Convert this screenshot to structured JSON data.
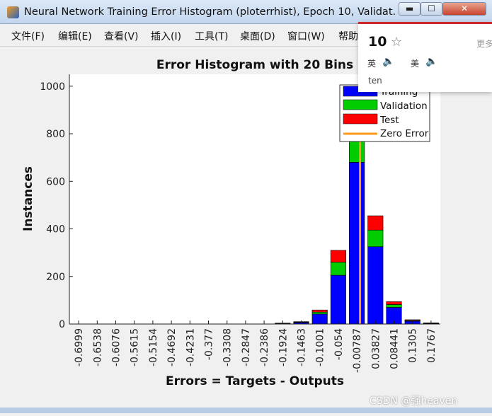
{
  "window": {
    "title": "Neural Network Training Error Histogram (ploterrhist), Epoch 10, Validat...",
    "controls": {
      "minimize": "▬",
      "maximize": "☐",
      "close": "✕"
    }
  },
  "menubar": {
    "items": [
      "文件(F)",
      "编辑(E)",
      "查看(V)",
      "插入(I)",
      "工具(T)",
      "桌面(D)",
      "窗口(W)",
      "帮助"
    ]
  },
  "chart_data": {
    "type": "bar",
    "title": "Error Histogram with 20 Bins",
    "xlabel": "Errors = Targets - Outputs",
    "ylabel": "Instances",
    "ylim": [
      0,
      1050
    ],
    "yticks": [
      "0",
      "200",
      "400",
      "600",
      "800",
      "1000"
    ],
    "categories": [
      "-0.6999",
      "-0.6538",
      "-0.6076",
      "-0.5615",
      "-0.5154",
      "-0.4692",
      "-0.4231",
      "-0.377",
      "-0.3308",
      "-0.2847",
      "-0.2386",
      "-0.1924",
      "-0.1463",
      "-0.1001",
      "-0.054",
      "-0.00787",
      "0.03827",
      "0.08441",
      "0.1305",
      "0.1767"
    ],
    "series": [
      {
        "name": "Training",
        "color": "#0000ff",
        "values": [
          0,
          0,
          0,
          0,
          0,
          0,
          0,
          0,
          0,
          0,
          0,
          2,
          6,
          42,
          205,
          680,
          325,
          70,
          12,
          3
        ]
      },
      {
        "name": "Validation",
        "color": "#00cc00",
        "values": [
          0,
          0,
          0,
          0,
          0,
          0,
          0,
          0,
          0,
          0,
          0,
          1,
          2,
          8,
          55,
          150,
          70,
          12,
          3,
          1
        ]
      },
      {
        "name": "Test",
        "color": "#ff0000",
        "values": [
          0,
          0,
          0,
          0,
          0,
          0,
          0,
          0,
          0,
          0,
          0,
          1,
          2,
          9,
          50,
          160,
          60,
          12,
          3,
          1
        ]
      }
    ],
    "zero_error": {
      "name": "Zero Error",
      "color": "#ff9a1a",
      "x": 0
    },
    "legend_position": "top-right",
    "grid": false
  },
  "dictionary_popup": {
    "word": "10",
    "star": "☆",
    "more": "更多",
    "uk_label": "英",
    "us_label": "美",
    "speaker": "🔈",
    "meaning": "ten"
  },
  "watermark": "CSDN @强heaven"
}
